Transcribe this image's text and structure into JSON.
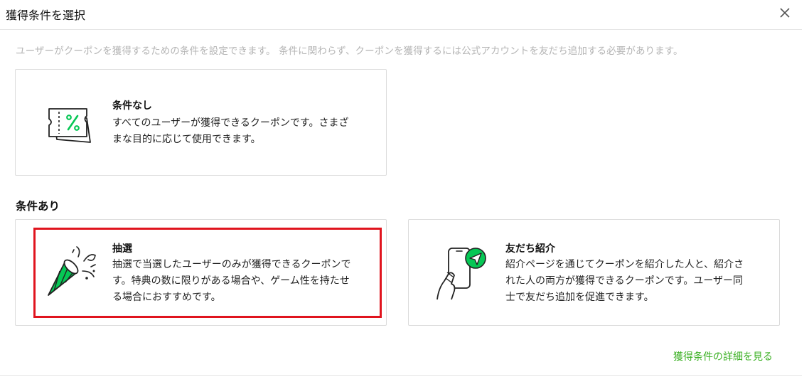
{
  "dialog": {
    "title": "獲得条件を選択",
    "description": "ユーザーがクーポンを獲得するための条件を設定できます。 条件に関わらず、クーポンを獲得するには公式アカウントを友だち追加する必要があります。"
  },
  "options": {
    "no_condition": {
      "title": "条件なし",
      "line1": "すべてのユーザーが獲得できるクーポンです。さまざ",
      "line2": "まな目的に応じて使用できます。"
    },
    "section_title": "条件あり",
    "lottery": {
      "title": "抽選",
      "line1": "抽選で当選したユーザーのみが獲得できるクーポンで",
      "line2": "す。特典の数に限りがある場合や、ゲーム性を持たせ",
      "line3": "る場合におすすめです。"
    },
    "referral": {
      "title": "友だち紹介",
      "line1": "紹介ページを通じてクーポンを紹介した人と、紹介さ",
      "line2": "れた人の両方が獲得できるクーポンです。ユーザー同",
      "line3": "士で友だち追加を促進できます。"
    }
  },
  "footer": {
    "details_link": "獲得条件の詳細を見る"
  },
  "colors": {
    "accent_green": "#3bb023",
    "icon_green": "#06c755",
    "highlight_red": "#e0141e"
  },
  "icons": [
    "close-icon",
    "coupon-icon",
    "party-popper-icon",
    "phone-share-icon"
  ]
}
